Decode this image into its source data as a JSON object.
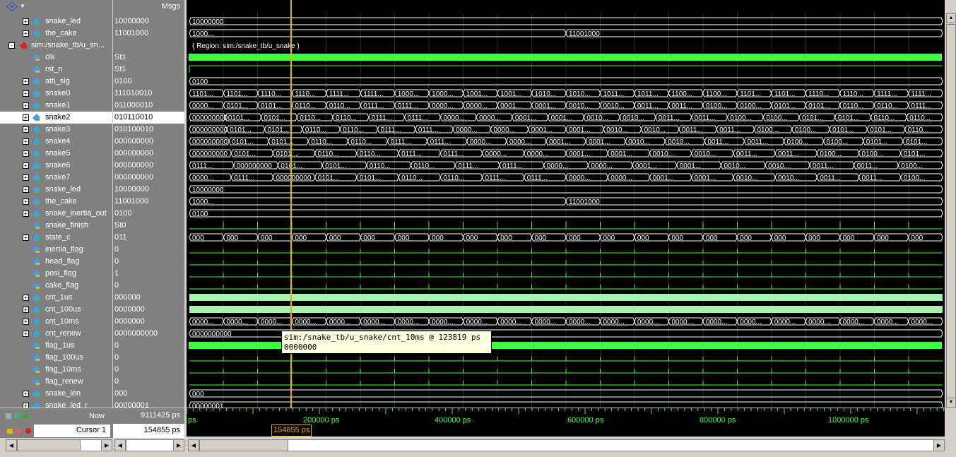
{
  "header": {
    "msgs_label": "Msgs"
  },
  "signals": [
    {
      "name": "snake_led",
      "value": "10000000",
      "expand": "+",
      "icon": "bus",
      "indent": 1
    },
    {
      "name": "the_cake",
      "value": "11001000",
      "expand": "+",
      "icon": "bus",
      "indent": 1
    },
    {
      "name": "sim:/snake_tb/u_sn...",
      "value": "",
      "expand": "-",
      "icon": "region",
      "indent": 0
    },
    {
      "name": "clk",
      "value": "St1",
      "expand": "",
      "icon": "wire",
      "indent": 2
    },
    {
      "name": "rst_n",
      "value": "St1",
      "expand": "",
      "icon": "wire",
      "indent": 2
    },
    {
      "name": "atti_sig",
      "value": "0100",
      "expand": "+",
      "icon": "bus",
      "indent": 1
    },
    {
      "name": "snake0",
      "value": "111010010",
      "expand": "+",
      "icon": "bus",
      "indent": 1
    },
    {
      "name": "snake1",
      "value": "011000010",
      "expand": "+",
      "icon": "bus",
      "indent": 1
    },
    {
      "name": "snake2",
      "value": "010110010",
      "expand": "+",
      "icon": "bus",
      "indent": 1,
      "selected": true
    },
    {
      "name": "snake3",
      "value": "010100010",
      "expand": "+",
      "icon": "bus",
      "indent": 1
    },
    {
      "name": "snake4",
      "value": "000000000",
      "expand": "+",
      "icon": "bus",
      "indent": 1
    },
    {
      "name": "snake5",
      "value": "000000000",
      "expand": "+",
      "icon": "bus",
      "indent": 1
    },
    {
      "name": "snake6",
      "value": "000000000",
      "expand": "+",
      "icon": "bus",
      "indent": 1
    },
    {
      "name": "snake7",
      "value": "000000000",
      "expand": "+",
      "icon": "bus",
      "indent": 1
    },
    {
      "name": "snake_led",
      "value": "10000000",
      "expand": "+",
      "icon": "bus",
      "indent": 1
    },
    {
      "name": "the_cake",
      "value": "11001000",
      "expand": "+",
      "icon": "bus",
      "indent": 1
    },
    {
      "name": "snake_inertia_out",
      "value": "0100",
      "expand": "+",
      "icon": "bus",
      "indent": 1
    },
    {
      "name": "snake_finish",
      "value": "St0",
      "expand": "",
      "icon": "wire",
      "indent": 2
    },
    {
      "name": "state_c",
      "value": "011",
      "expand": "+",
      "icon": "bus",
      "indent": 1
    },
    {
      "name": "inertia_flag",
      "value": "0",
      "expand": "",
      "icon": "wire",
      "indent": 2
    },
    {
      "name": "head_flag",
      "value": "0",
      "expand": "",
      "icon": "wire",
      "indent": 2
    },
    {
      "name": "posi_flag",
      "value": "1",
      "expand": "",
      "icon": "wire",
      "indent": 2
    },
    {
      "name": "cake_flag",
      "value": "0",
      "expand": "",
      "icon": "wire",
      "indent": 2
    },
    {
      "name": "cnt_1us",
      "value": "000000",
      "expand": "+",
      "icon": "bus",
      "indent": 1
    },
    {
      "name": "cnt_100us",
      "value": "0000000",
      "expand": "+",
      "icon": "bus",
      "indent": 1
    },
    {
      "name": "cnt_10ms",
      "value": "0000000",
      "expand": "+",
      "icon": "bus",
      "indent": 1
    },
    {
      "name": "cnt_renew",
      "value": "0000000000",
      "expand": "+",
      "icon": "bus",
      "indent": 1
    },
    {
      "name": "flag_1us",
      "value": "0",
      "expand": "",
      "icon": "wire",
      "indent": 2
    },
    {
      "name": "flag_100us",
      "value": "0",
      "expand": "",
      "icon": "wire",
      "indent": 2
    },
    {
      "name": "flag_10ms",
      "value": "0",
      "expand": "",
      "icon": "wire",
      "indent": 2
    },
    {
      "name": "flag_renew",
      "value": "0",
      "expand": "",
      "icon": "wire",
      "indent": 2
    },
    {
      "name": "snake_len",
      "value": "000",
      "expand": "+",
      "icon": "bus",
      "indent": 1
    },
    {
      "name": "snake_led_r",
      "value": "00000001",
      "expand": "+",
      "icon": "bus",
      "indent": 1
    }
  ],
  "waves": [
    {
      "type": "bus",
      "labels": [
        "10000000"
      ]
    },
    {
      "type": "bus",
      "labels": [
        "1000...",
        "11001000"
      ]
    },
    {
      "type": "text",
      "text": "( Region: sim:/snake_tb/u_snake )"
    },
    {
      "type": "clk"
    },
    {
      "type": "high_after_rise"
    },
    {
      "type": "bus",
      "labels": [
        "0100"
      ]
    },
    {
      "type": "bus",
      "labels": [
        "1101...",
        "1101...",
        "1110...",
        "1110...",
        "1111...",
        "1111...",
        "1000...",
        "1000...",
        "1001...",
        "1001...",
        "1010...",
        "1010...",
        "1011...",
        "1011...",
        "1100...",
        "1100...",
        "1101...",
        "1101...",
        "1110...",
        "1110...",
        "1111...",
        "1111..."
      ]
    },
    {
      "type": "bus",
      "labels": [
        "0000...",
        "0101...",
        "0101...",
        "0110...",
        "0110...",
        "0111...",
        "0111...",
        "0000...",
        "0000...",
        "0001...",
        "0001...",
        "0010...",
        "0010...",
        "0011...",
        "0011...",
        "0100...",
        "0100...",
        "0101...",
        "0101...",
        "0110...",
        "0110...",
        "0111..."
      ]
    },
    {
      "type": "bus",
      "labels": [
        "000000000",
        "0101...",
        "0101...",
        "0110...",
        "0110...",
        "0111...",
        "0111...",
        "0000...",
        "0000...",
        "0001...",
        "0001...",
        "0010...",
        "0010...",
        "0011...",
        "0011...",
        "0100...",
        "0100...",
        "0101...",
        "0101...",
        "0110...",
        "0110..."
      ]
    },
    {
      "type": "bus",
      "labels": [
        "000000000",
        "0101...",
        "0101...",
        "0110...",
        "0110...",
        "0111...",
        "0111...",
        "0000...",
        "0000...",
        "0001...",
        "0001...",
        "0010...",
        "0010...",
        "0011...",
        "0011...",
        "0100...",
        "0100...",
        "0101...",
        "0101...",
        "0110..."
      ]
    },
    {
      "type": "bus",
      "labels": [
        "000000000",
        "0101...",
        "0101...",
        "0110...",
        "0110...",
        "0111...",
        "0111...",
        "0000...",
        "0000...",
        "0001...",
        "0001...",
        "0010...",
        "0010...",
        "0011...",
        "0011...",
        "0100...",
        "0100...",
        "0101...",
        "0101..."
      ]
    },
    {
      "type": "bus",
      "labels": [
        "000000000",
        "0101...",
        "0101...",
        "0110...",
        "0110...",
        "0111...",
        "0111...",
        "0000...",
        "0000...",
        "0001...",
        "0001...",
        "0010...",
        "0010...",
        "0011...",
        "0011...",
        "0100...",
        "0100...",
        "0101..."
      ]
    },
    {
      "type": "bus",
      "labels": [
        "0111...",
        "000000000",
        "0101...",
        "0101...",
        "0110...",
        "0110...",
        "0111...",
        "0111...",
        "0000...",
        "0000...",
        "0001...",
        "0001...",
        "0010...",
        "0010...",
        "0011...",
        "0011...",
        "0100..."
      ]
    },
    {
      "type": "bus",
      "labels": [
        "0000...",
        "0111...",
        "000000000",
        "0101...",
        "0101...",
        "0110...",
        "0110...",
        "0111...",
        "0111...",
        "0000...",
        "0000...",
        "0001...",
        "0001...",
        "0010...",
        "0010...",
        "0011...",
        "0011...",
        "0100..."
      ]
    },
    {
      "type": "bus",
      "labels": [
        "10000000"
      ]
    },
    {
      "type": "bus",
      "labels": [
        "1000...",
        "11001000"
      ]
    },
    {
      "type": "bus",
      "labels": [
        "0100"
      ]
    },
    {
      "type": "pulses"
    },
    {
      "type": "bus",
      "labels": [
        "000",
        "000",
        "000",
        "000",
        "000",
        "000",
        "000",
        "000",
        "000",
        "000",
        "000",
        "000",
        "000",
        "000",
        "000",
        "000",
        "000",
        "000",
        "000",
        "000",
        "000",
        "000"
      ]
    },
    {
      "type": "pulses_low"
    },
    {
      "type": "pulses_low"
    },
    {
      "type": "pulses_low"
    },
    {
      "type": "pulses_low"
    },
    {
      "type": "dense"
    },
    {
      "type": "dense"
    },
    {
      "type": "bus",
      "labels": [
        "0000...",
        "0000...",
        "0000...",
        "0000...",
        "0000...",
        "0000...",
        "0000...",
        "0000...",
        "0000...",
        "0000...",
        "0000...",
        "0000...",
        "0000...",
        "0000...",
        "0000...",
        "0000...",
        "0000...",
        "0000...",
        "0000...",
        "0000...",
        "0000...",
        "0000..."
      ]
    },
    {
      "type": "bus",
      "labels": [
        "0000000000"
      ]
    },
    {
      "type": "clk"
    },
    {
      "type": "pulses_low"
    },
    {
      "type": "pulses_low"
    },
    {
      "type": "pulses_low"
    },
    {
      "type": "bus",
      "labels": [
        "000"
      ]
    },
    {
      "type": "bus",
      "labels": [
        "00000001"
      ]
    }
  ],
  "bottom": {
    "now_label": "Now",
    "now_value": "9111425 ps",
    "cursor_label": "Cursor 1",
    "cursor_value": "154855 ps"
  },
  "timeline": {
    "ticks": [
      "ps",
      "200000 ps",
      "400000 ps",
      "600000 ps",
      "800000 ps",
      "1000000 ps"
    ],
    "cursor_time": "154855 ps"
  },
  "tooltip": {
    "line1": "sim:/snake_tb/u_snake/cnt_10ms @ 123819 ps",
    "line2": "0000000"
  },
  "colors": {
    "wave_green": "#40ff40",
    "cursor": "#e8b000",
    "light_fill": "#a8f0b0"
  }
}
